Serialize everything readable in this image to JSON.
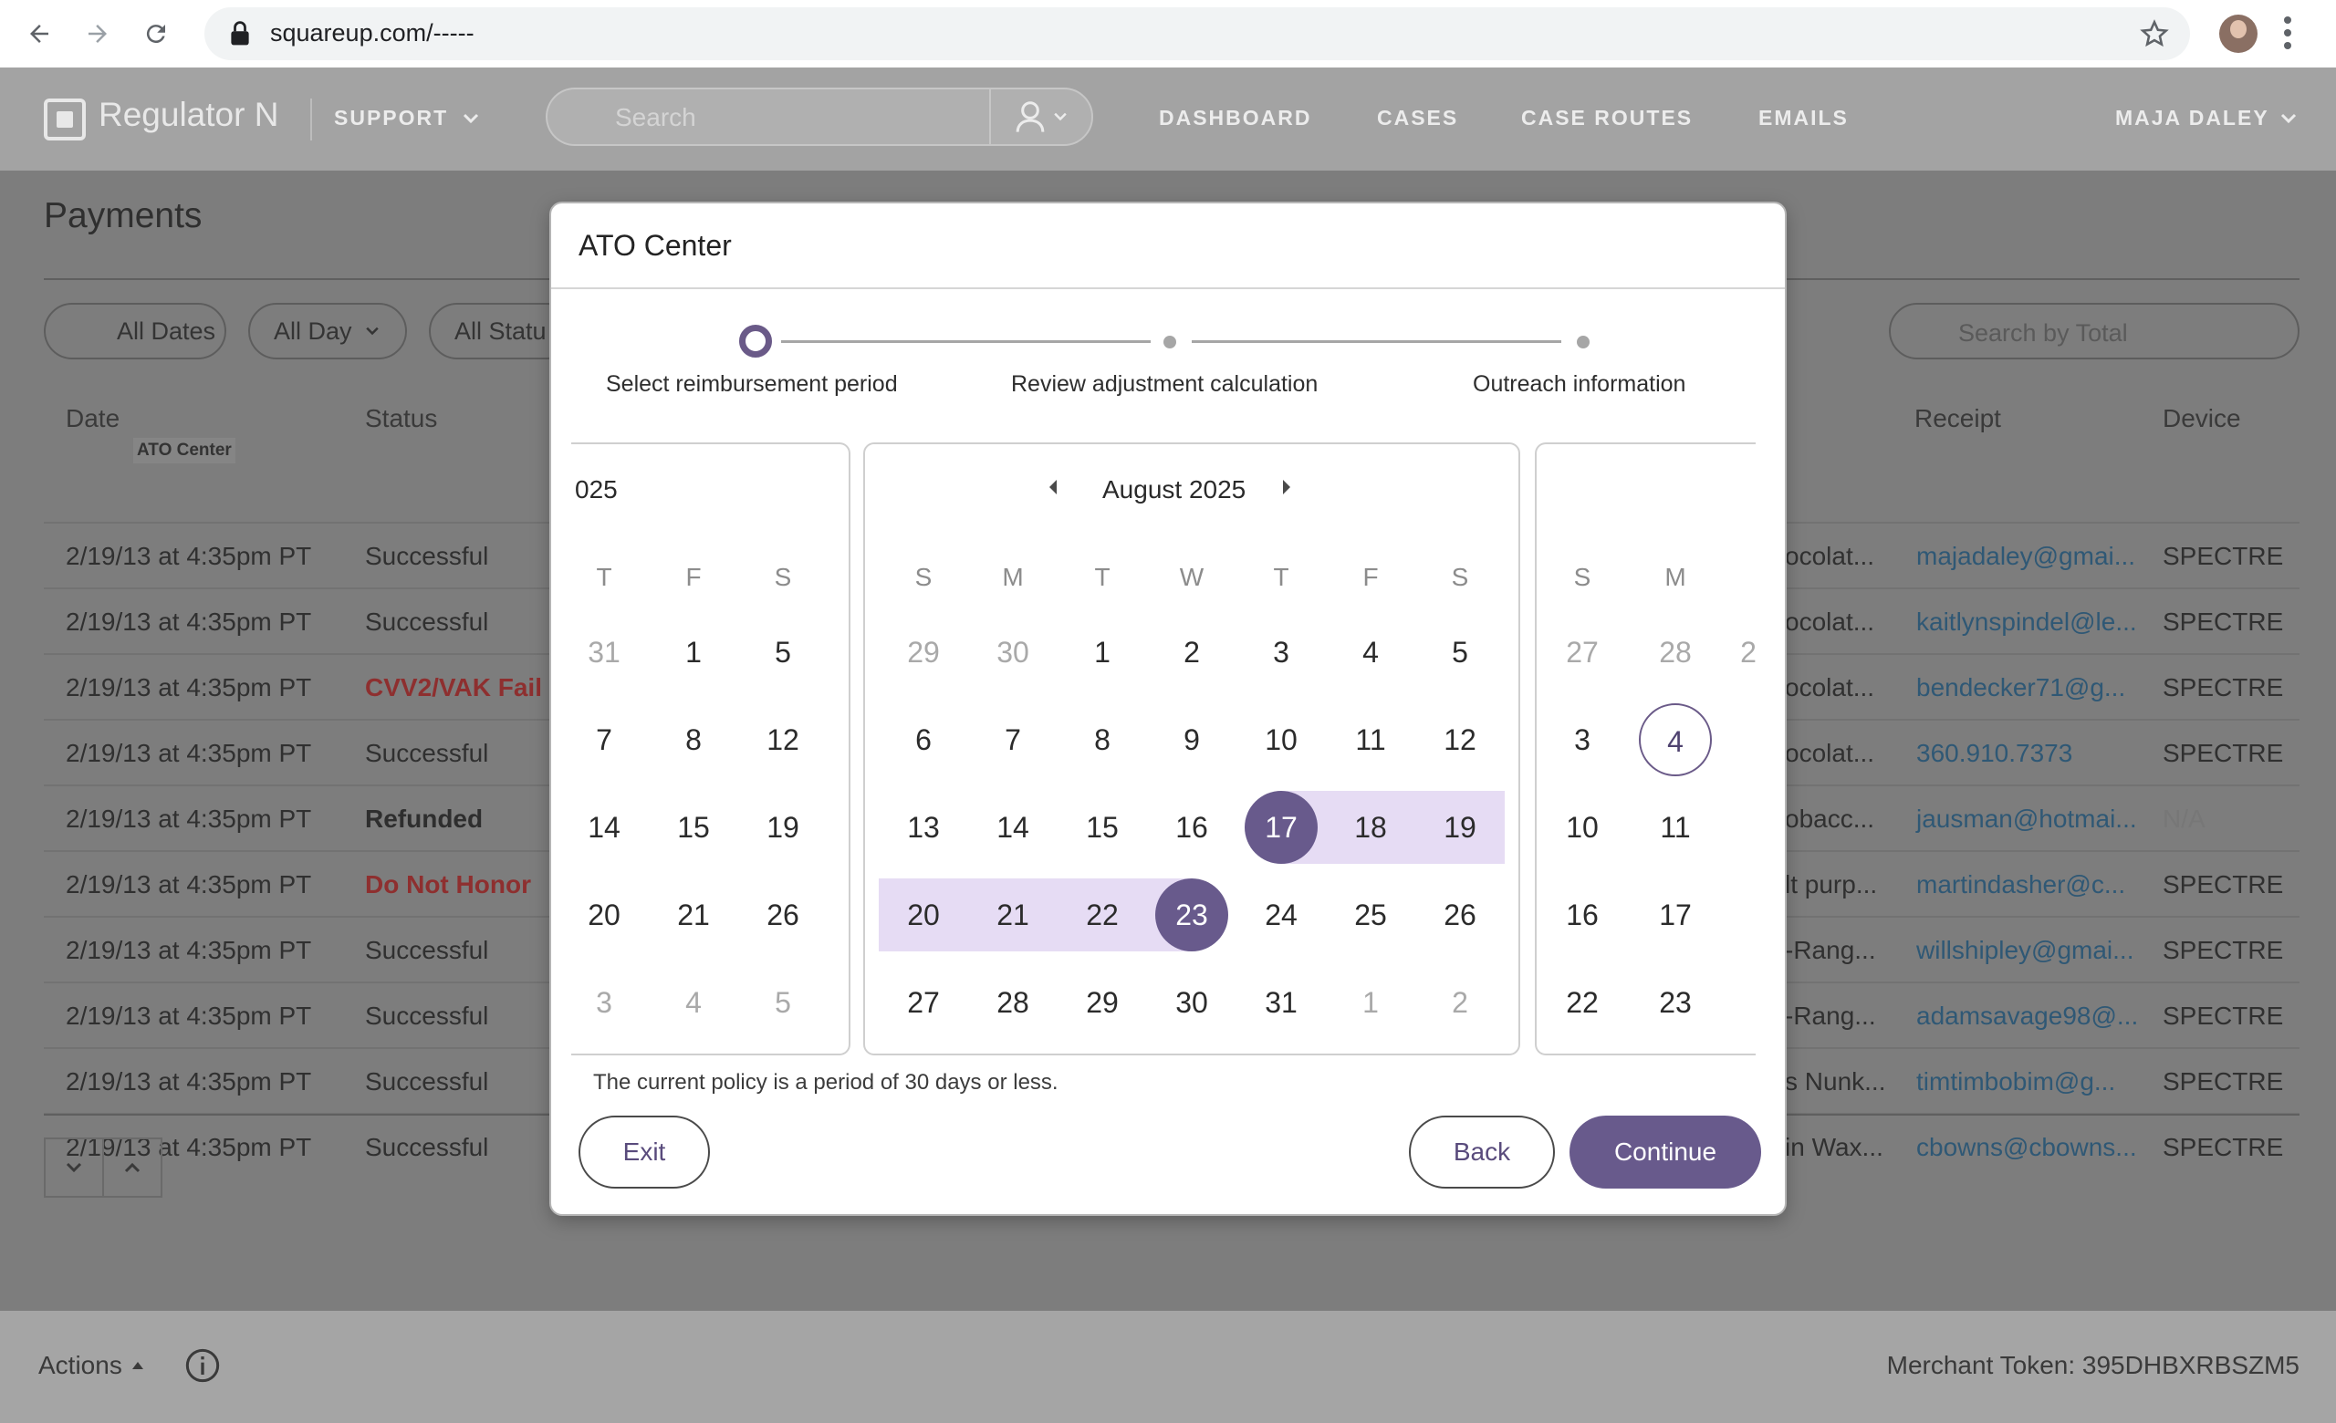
{
  "browser": {
    "url": "squareup.com/-----"
  },
  "nav": {
    "brand": "Regulator N",
    "support": "SUPPORT",
    "search_placeholder": "Search",
    "links": [
      "DASHBOARD",
      "CASES",
      "CASE ROUTES",
      "EMAILS"
    ],
    "user": "MAJA DALEY"
  },
  "page": {
    "title": "Payments",
    "filters": [
      "All Dates",
      "All Day",
      "All Statu"
    ],
    "search_total_placeholder": "Search by Total",
    "columns": {
      "date": "Date",
      "status": "Status",
      "receipt": "Receipt",
      "device": "Device"
    },
    "tooltip": "ATO Center",
    "rows": [
      {
        "date": "2/19/13 at 4:35pm PT",
        "status": "Successful",
        "item": "ocolat...",
        "receipt": "majadaley@gmai...",
        "device": "SPECTRE"
      },
      {
        "date": "2/19/13 at 4:35pm PT",
        "status": "Successful",
        "item": "ocolat...",
        "receipt": "kaitlynspindel@le...",
        "device": "SPECTRE"
      },
      {
        "date": "2/19/13 at 4:35pm PT",
        "status": "CVV2/VAK Fail",
        "item": "ocolat...",
        "receipt": "bendecker71@g...",
        "device": "SPECTRE"
      },
      {
        "date": "2/19/13 at 4:35pm PT",
        "status": "Successful",
        "item": "ocolat...",
        "receipt": "360.910.7373",
        "device": "SPECTRE"
      },
      {
        "date": "2/19/13 at 4:35pm PT",
        "status": "Refunded",
        "item": "obacc...",
        "receipt": "jausman@hotmai...",
        "device": "N/A"
      },
      {
        "date": "2/19/13 at 4:35pm PT",
        "status": "Do Not Honor",
        "item": "lt purp...",
        "receipt": "martindasher@c...",
        "device": "SPECTRE"
      },
      {
        "date": "2/19/13 at 4:35pm PT",
        "status": "Successful",
        "item": "-Rang...",
        "receipt": "willshipley@gmai...",
        "device": "SPECTRE"
      },
      {
        "date": "2/19/13 at 4:35pm PT",
        "status": "Successful",
        "item": "-Rang...",
        "receipt": "adamsavage98@...",
        "device": "SPECTRE"
      },
      {
        "date": "2/19/13 at 4:35pm PT",
        "status": "Successful",
        "item": "s Nunk...",
        "receipt": "timtimbobim@g...",
        "device": "SPECTRE"
      },
      {
        "date": "2/19/13 at 4:35pm PT",
        "status": "Successful",
        "item": "in Wax...",
        "receipt": "cbowns@cbowns...",
        "device": "SPECTRE"
      }
    ]
  },
  "footer": {
    "actions": "Actions",
    "merchant_token": "Merchant Token: 395DHBXRBSZM5"
  },
  "modal": {
    "title": "ATO Center",
    "steps": [
      "Select reimbursement period",
      "Review adjustment calculation",
      "Outreach information"
    ],
    "active_step": 0,
    "calendars": {
      "left": {
        "title": "025",
        "dow": [
          "T",
          "F",
          "S"
        ],
        "weeks": [
          [
            "31",
            "1",
            "5"
          ],
          [
            "7",
            "8",
            "12"
          ],
          [
            "14",
            "15",
            "19"
          ],
          [
            "20",
            "21",
            "26"
          ],
          [
            "3",
            "4",
            "5"
          ]
        ]
      },
      "center": {
        "title": "August 2025",
        "dow": [
          "S",
          "M",
          "T",
          "W",
          "T",
          "F",
          "S"
        ],
        "weeks": [
          [
            "29",
            "30",
            "1",
            "2",
            "3",
            "4",
            "5"
          ],
          [
            "6",
            "7",
            "8",
            "9",
            "10",
            "11",
            "12"
          ],
          [
            "13",
            "14",
            "15",
            "16",
            "17",
            "18",
            "19"
          ],
          [
            "20",
            "21",
            "22",
            "23",
            "24",
            "25",
            "26"
          ],
          [
            "27",
            "28",
            "29",
            "30",
            "31",
            "1",
            "2"
          ]
        ],
        "range_start": "17",
        "range_end": "23"
      },
      "right": {
        "dow": [
          "S",
          "M"
        ],
        "weeks": [
          [
            "27",
            "28",
            "2"
          ],
          [
            "3",
            "4"
          ],
          [
            "10",
            "11"
          ],
          [
            "16",
            "17"
          ],
          [
            "22",
            "23"
          ]
        ],
        "today": "4"
      }
    },
    "policy_text": "The current policy is a period of 30 days or less.",
    "exit_label": "Exit",
    "back_label": "Back",
    "continue_label": "Continue"
  }
}
